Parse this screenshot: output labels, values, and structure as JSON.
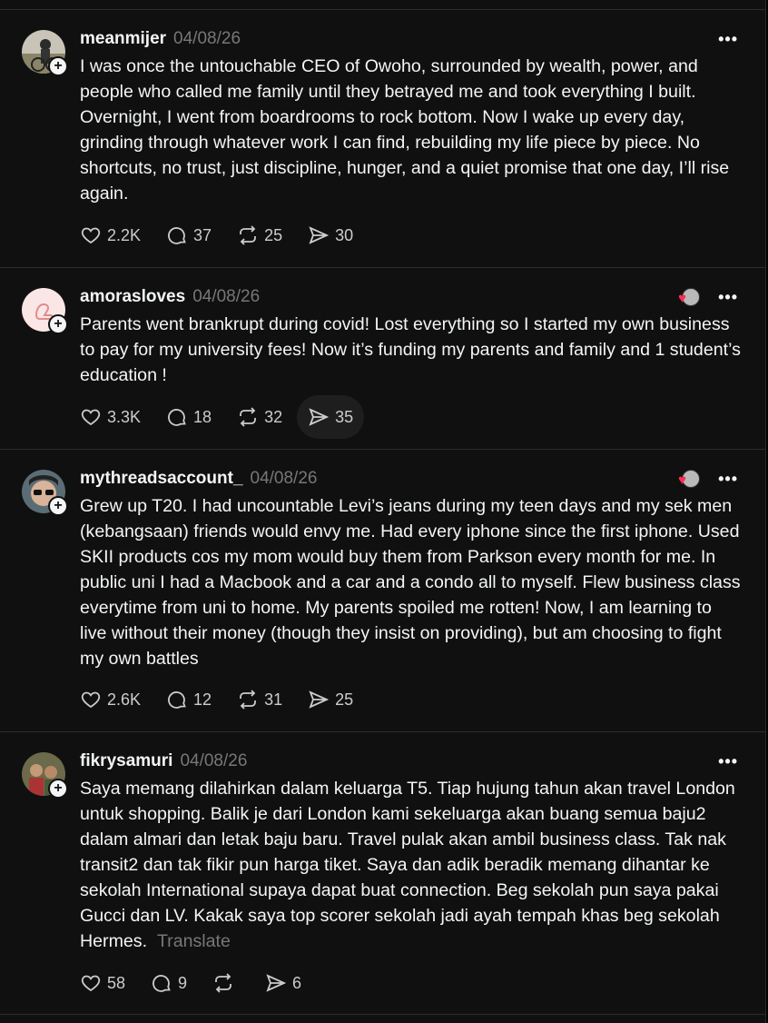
{
  "colors": {
    "background": "#101010",
    "text": "#f3f5f7",
    "muted": "#777777",
    "heart": "#ff2d55"
  },
  "posts": [
    {
      "username": "meanmijer",
      "date": "04/08/26",
      "text": "I was once the untouchable CEO of Owoho, surrounded by wealth, power, and people who called me family until they betrayed me and took everything I built. Overnight, I went from boardrooms to rock bottom. Now I wake up every day, grinding through whatever work I can find, rebuilding my life piece by piece. No shortcuts, no trust, just discipline, hunger, and a quiet promise that one day, I’ll rise again.",
      "likes": "2.2K",
      "replies": "37",
      "reposts": "25",
      "shares": "30"
    },
    {
      "username": "amorasloves",
      "date": "04/08/26",
      "text": "Parents went brankrupt during covid! Lost everything so I started my own business to pay for my university fees! Now it’s funding my parents and family and 1 student’s education !",
      "likes": "3.3K",
      "replies": "18",
      "reposts": "32",
      "shares": "35"
    },
    {
      "username": "mythreadsaccount_",
      "date": "04/08/26",
      "text": "Grew up T20. I had uncountable Levi’s jeans during my teen days and my sek men (kebangsaan) friends would envy me. Had every iphone since the first iphone. Used SKII products cos my mom would buy them from Parkson every month for me. In public uni I had a Macbook and a car and a condo all to myself. Flew business class everytime from uni to home. My parents spoiled me rotten! Now, I am learning to live without their money (though they insist on providing), but am choosing to fight my own battles",
      "likes": "2.6K",
      "replies": "12",
      "reposts": "31",
      "shares": "25"
    },
    {
      "username": "fikrysamuri",
      "date": "04/08/26",
      "text": "Saya memang dilahirkan dalam keluarga T5. Tiap hujung tahun akan travel London untuk shopping. Balik je dari London kami sekeluarga akan buang semua baju2 dalam almari dan letak baju baru. Travel pulak akan ambil business class. Tak nak transit2 dan tak fikir pun harga tiket. Saya dan adik beradik memang dihantar ke sekolah International supaya dapat buat connection. Beg sekolah pun saya pakai Gucci dan LV. Kakak saya top scorer sekolah jadi ayah tempah khas beg sekolah Hermes.",
      "translate_label": "Translate",
      "likes": "58",
      "replies": "9",
      "reposts": "",
      "shares": "6"
    }
  ]
}
